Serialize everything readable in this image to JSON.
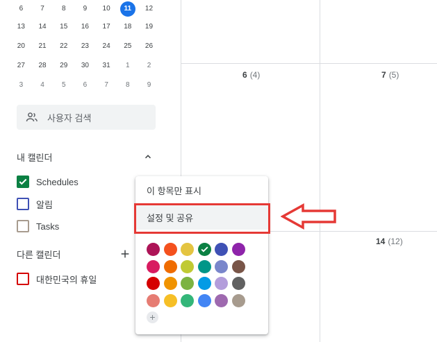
{
  "mini_calendar": {
    "weeks": [
      [
        {
          "d": "6"
        },
        {
          "d": "7"
        },
        {
          "d": "8"
        },
        {
          "d": "9"
        },
        {
          "d": "10"
        },
        {
          "d": "11",
          "today": true
        },
        {
          "d": "12"
        }
      ],
      [
        {
          "d": "13"
        },
        {
          "d": "14"
        },
        {
          "d": "15"
        },
        {
          "d": "16"
        },
        {
          "d": "17"
        },
        {
          "d": "18"
        },
        {
          "d": "19"
        }
      ],
      [
        {
          "d": "20"
        },
        {
          "d": "21"
        },
        {
          "d": "22"
        },
        {
          "d": "23"
        },
        {
          "d": "24"
        },
        {
          "d": "25"
        },
        {
          "d": "26"
        }
      ],
      [
        {
          "d": "27"
        },
        {
          "d": "28"
        },
        {
          "d": "29"
        },
        {
          "d": "30"
        },
        {
          "d": "31"
        },
        {
          "d": "1",
          "other": true
        },
        {
          "d": "2",
          "other": true
        }
      ],
      [
        {
          "d": "3",
          "other": true
        },
        {
          "d": "4",
          "other": true
        },
        {
          "d": "5",
          "other": true
        },
        {
          "d": "6",
          "other": true
        },
        {
          "d": "7",
          "other": true
        },
        {
          "d": "8",
          "other": true
        },
        {
          "d": "9",
          "other": true
        }
      ]
    ]
  },
  "search_people": {
    "label": "사용자 검색",
    "icon": "people-icon"
  },
  "my_calendars": {
    "title": "내 캘린더",
    "toggle_icon": "chevron-up-icon",
    "items": [
      {
        "label": "Schedules",
        "color": "#0b8043",
        "checked": true
      },
      {
        "label": "알림",
        "color": "#3f51b5",
        "checked": false
      },
      {
        "label": "Tasks",
        "color": "#a79b8e",
        "checked": false
      }
    ]
  },
  "other_calendars": {
    "title": "다른 캘린더",
    "add_icon": "plus-icon",
    "items": [
      {
        "label": "대한민국의 휴일",
        "color": "#d50000",
        "checked": false
      }
    ]
  },
  "grid": {
    "cells": [
      {
        "date": "6",
        "week": "(4)"
      },
      {
        "date": "7",
        "week": "(5)"
      },
      {
        "date": "14",
        "week": "(12)"
      }
    ]
  },
  "popup_menu": {
    "items": [
      {
        "label": "이 항목만 표시"
      },
      {
        "label": "설정 및 공유",
        "highlighted": true
      }
    ],
    "colors": [
      [
        "#ad1457",
        "#f4511e",
        "#e4c441",
        "#0b8043",
        "#3f51b5",
        "#8e24aa"
      ],
      [
        "#d81b60",
        "#ef6c00",
        "#c0ca33",
        "#009688",
        "#7986cb",
        "#795548"
      ],
      [
        "#d50000",
        "#f09300",
        "#7cb342",
        "#039be5",
        "#b39ddb",
        "#616161"
      ],
      [
        "#e67c73",
        "#f6bf26",
        "#33b679",
        "#4285f4",
        "#9e69af",
        "#a79b8e"
      ]
    ],
    "selected_color": "#0b8043",
    "add_color_icon": "plus-icon"
  },
  "annotation": {
    "box_color": "#e53935",
    "arrow_icon": "left-arrow-icon"
  }
}
